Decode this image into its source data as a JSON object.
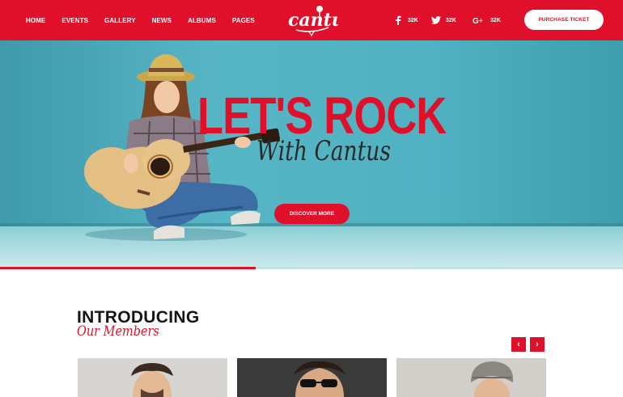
{
  "header": {
    "nav": [
      "HOME",
      "EVENTS",
      "GALLERY",
      "NEWS",
      "ALBUMS",
      "PAGES"
    ],
    "logo_text": "cantus",
    "social": [
      {
        "icon": "facebook-icon",
        "count": "32K"
      },
      {
        "icon": "twitter-icon",
        "count": "32K"
      },
      {
        "icon": "google-plus-icon",
        "count": "32K"
      }
    ],
    "ticket_label": "PURCHASE TICKET"
  },
  "hero": {
    "title": "LET'S ROCK",
    "subtitle": "With Cantus",
    "button_label": "DISCOVER MORE",
    "progress": 0.41
  },
  "members": {
    "title": "INTRODUCING",
    "subtitle": "Our Members",
    "prev_label": "‹",
    "next_label": "›"
  },
  "colors": {
    "brand_red": "#e0102b",
    "hero_teal": "#4fb1c1"
  }
}
